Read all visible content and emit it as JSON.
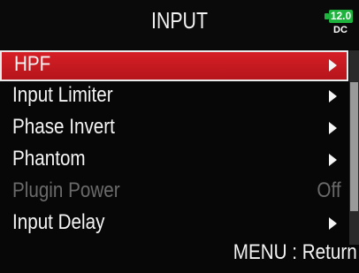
{
  "header": {
    "title": "INPUT",
    "battery": {
      "voltage": "12.0",
      "source": "DC",
      "color": "#1db33c"
    }
  },
  "menu": {
    "items": [
      {
        "label": "HPF",
        "state": "selected",
        "indicator": "arrow-right-icon"
      },
      {
        "label": "Input Limiter",
        "state": "normal",
        "indicator": "arrow-right-icon"
      },
      {
        "label": "Phase Invert",
        "state": "normal",
        "indicator": "arrow-right-icon"
      },
      {
        "label": "Phantom",
        "state": "normal",
        "indicator": "arrow-right-icon"
      },
      {
        "label": "Plugin Power",
        "state": "disabled",
        "value": "Off"
      },
      {
        "label": "Input Delay",
        "state": "normal",
        "indicator": "arrow-right-icon"
      }
    ],
    "selected_color": "#d61f26",
    "disabled_color": "#6a6a6a"
  },
  "footer": {
    "hint": "MENU : Return"
  }
}
